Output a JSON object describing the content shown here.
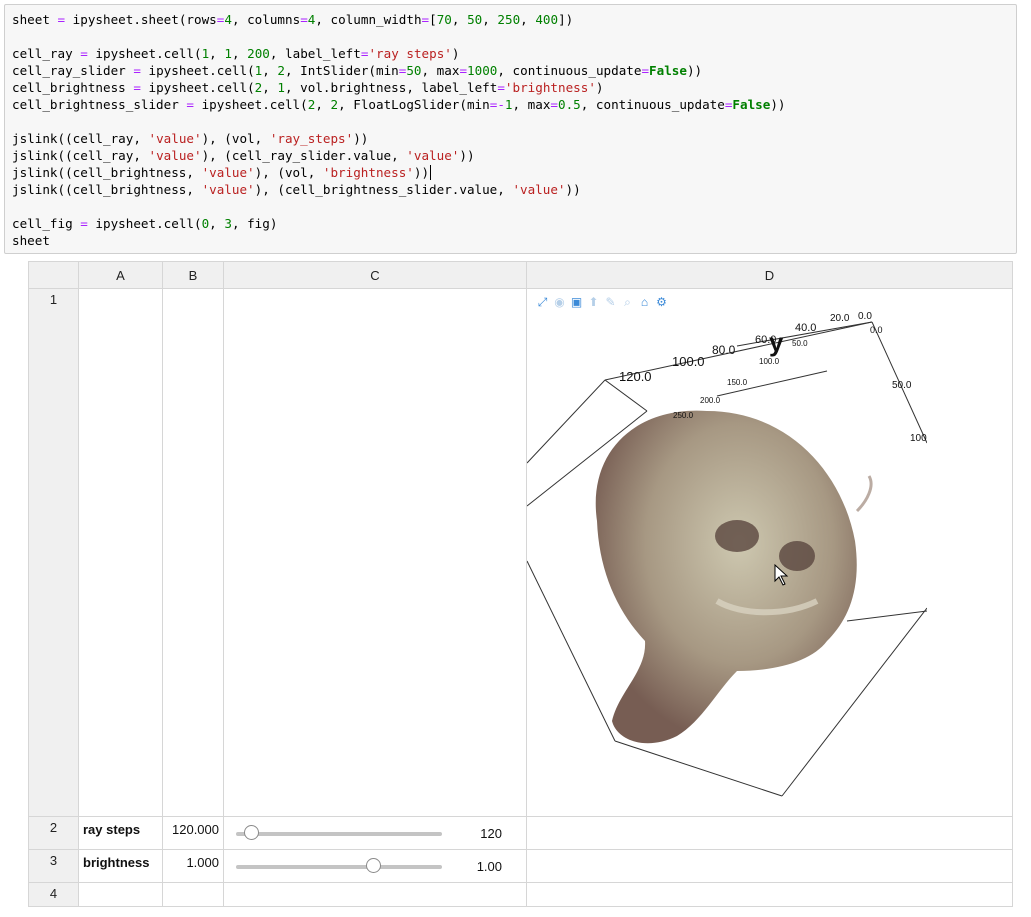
{
  "code": {
    "l1": {
      "a": "sheet ",
      "b": "=",
      "c": " ipysheet.sheet(rows",
      "d": "=",
      "e": "4",
      "f": ", columns",
      "g": "=",
      "h": "4",
      "i": ", column_width",
      "j": "=",
      "k": "[",
      "l": "70",
      "m": ", ",
      "n": "50",
      "o": ", ",
      "p": "250",
      "q": ", ",
      "r": "400",
      "s": "])"
    },
    "l3": {
      "a": "cell_ray ",
      "b": "=",
      "c": " ipysheet.cell(",
      "d": "1",
      "e": ", ",
      "f": "1",
      "g": ", ",
      "h": "200",
      "i": ", label_left",
      "j": "=",
      "k": "'ray steps'",
      "l": ")"
    },
    "l4": {
      "a": "cell_ray_slider ",
      "b": "=",
      "c": " ipysheet.cell(",
      "d": "1",
      "e": ", ",
      "f": "2",
      "g": ", IntSlider(min",
      "h": "=",
      "i": "50",
      "j": ", max",
      "k": "=",
      "l": "1000",
      "m": ", continuous_update",
      "n": "=",
      "o": "False",
      "p": "))"
    },
    "l5": {
      "a": "cell_brightness ",
      "b": "=",
      "c": " ipysheet.cell(",
      "d": "2",
      "e": ", ",
      "f": "1",
      "g": ", vol.brightness, label_left",
      "h": "=",
      "i": "'brightness'",
      "j": ")"
    },
    "l6": {
      "a": "cell_brightness_slider ",
      "b": "=",
      "c": " ipysheet.cell(",
      "d": "2",
      "e": ", ",
      "f": "2",
      "g": ", FloatLogSlider(min",
      "h": "=-",
      "i": "1",
      "j": ", max",
      "k": "=",
      "l": "0.5",
      "m": ", continuous_update",
      "n": "=",
      "o": "False",
      "p": "))"
    },
    "l8": {
      "a": "jslink((cell_ray, ",
      "b": "'value'",
      "c": "), (vol, ",
      "d": "'ray_steps'",
      "e": "))"
    },
    "l9": {
      "a": "jslink((cell_ray, ",
      "b": "'value'",
      "c": "), (cell_ray_slider.value, ",
      "d": "'value'",
      "e": "))"
    },
    "l10": {
      "a": "jslink((cell_brightness, ",
      "b": "'value'",
      "c": "), (vol, ",
      "d": "'brightness'",
      "e": "))"
    },
    "l11": {
      "a": "jslink((cell_brightness, ",
      "b": "'value'",
      "c": "), (cell_brightness_slider.value, ",
      "d": "'value'",
      "e": "))"
    },
    "l13": {
      "a": "cell_fig ",
      "b": "=",
      "c": " ipysheet.cell(",
      "d": "0",
      "e": ", ",
      "f": "3",
      "g": ", fig)"
    },
    "l14": "sheet"
  },
  "sheet": {
    "columns": [
      "A",
      "B",
      "C",
      "D"
    ],
    "rows": [
      "1",
      "2",
      "3",
      "4"
    ],
    "row2": {
      "label": "ray steps",
      "value": "120.000",
      "slider_value": "120",
      "slider_fraction": 0.074
    },
    "row3": {
      "label": "brightness",
      "value": "1.000",
      "slider_value": "1.00",
      "slider_fraction": 0.667
    }
  },
  "figure": {
    "axis_y": "y",
    "ticks_top": [
      "120.0",
      "100.0",
      "80.0",
      "60.0",
      "40.0",
      "20.0",
      "0.0"
    ],
    "ticks_mid": [
      "250.0",
      "200.0",
      "150.0",
      "100.0",
      "50.0",
      "0.0"
    ],
    "ticks_right": [
      "0.0",
      "50.0",
      "100."
    ]
  }
}
